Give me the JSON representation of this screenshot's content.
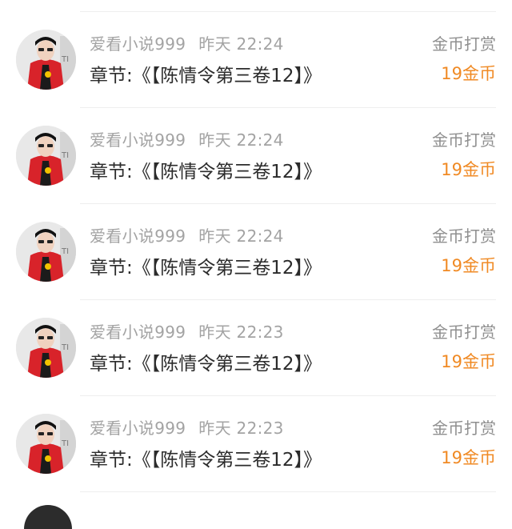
{
  "feed": {
    "items": [
      {
        "user": "爱看小说999",
        "time": "昨天 22:24",
        "chapter": "章节:《【陈情令第三卷12】》",
        "tip_label": "金币打赏",
        "tip_amount": "19金币"
      },
      {
        "user": "爱看小说999",
        "time": "昨天 22:24",
        "chapter": "章节:《【陈情令第三卷12】》",
        "tip_label": "金币打赏",
        "tip_amount": "19金币"
      },
      {
        "user": "爱看小说999",
        "time": "昨天 22:24",
        "chapter": "章节:《【陈情令第三卷12】》",
        "tip_label": "金币打赏",
        "tip_amount": "19金币"
      },
      {
        "user": "爱看小说999",
        "time": "昨天 22:23",
        "chapter": "章节:《【陈情令第三卷12】》",
        "tip_label": "金币打赏",
        "tip_amount": "19金币"
      },
      {
        "user": "爱看小说999",
        "time": "昨天 22:23",
        "chapter": "章节:《【陈情令第三卷12】》",
        "tip_label": "金币打赏",
        "tip_amount": "19金币"
      }
    ]
  },
  "colors": {
    "amount": "#f08a24",
    "secondary_text": "#a3a3a3",
    "primary_text": "#2b2b2b",
    "divider": "#eeeeee"
  }
}
